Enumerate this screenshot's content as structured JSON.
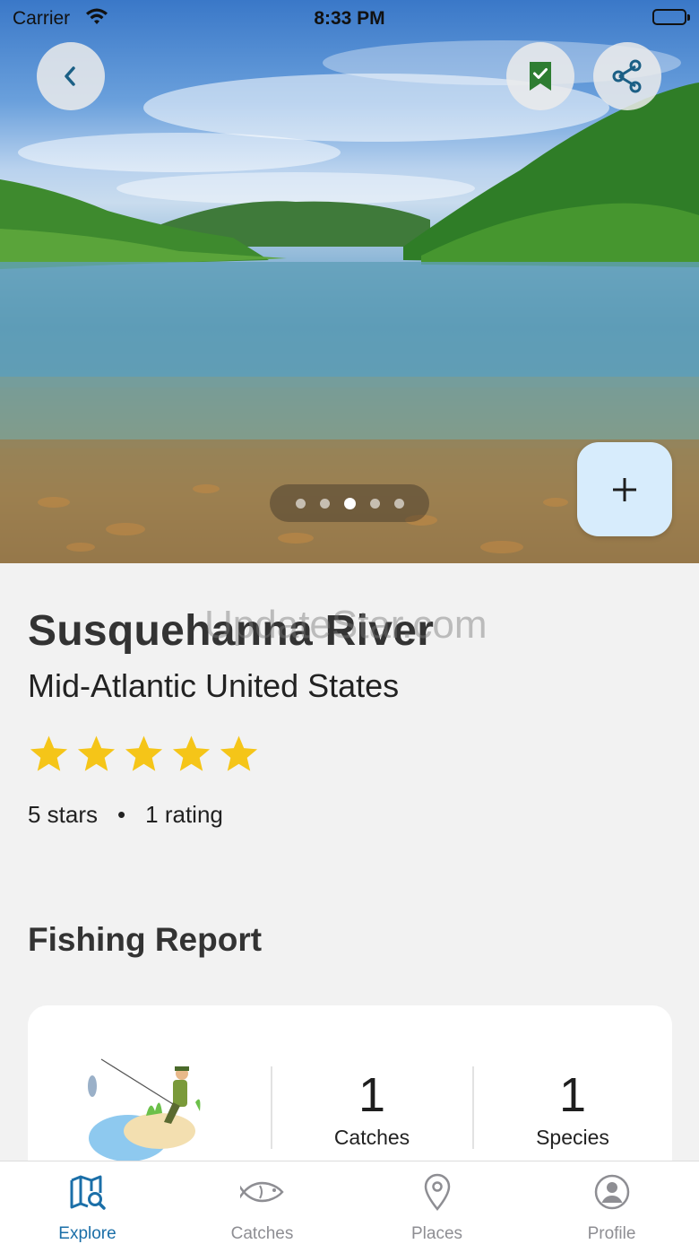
{
  "status_bar": {
    "carrier": "Carrier",
    "time": "8:33 PM"
  },
  "hero": {
    "image_description_icon": "river-landscape-photo",
    "page_count": 5,
    "active_page": 3,
    "back_icon": "chevron-left-icon",
    "bookmark_icon": "bookmark-check-icon",
    "share_icon": "share-icon",
    "add_icon": "plus-icon"
  },
  "place": {
    "name": "Susquehanna River",
    "region": "Mid-Atlantic United States",
    "watermark": "UpdateStar.com",
    "star_count": 5,
    "stars_text": "5 stars",
    "ratings_text": "1 rating"
  },
  "report": {
    "title": "Fishing Report",
    "catches_value": "1",
    "catches_label": "Catches",
    "species_value": "1",
    "species_label": "Species"
  },
  "tabs": [
    {
      "label": "Explore",
      "icon": "map-search-icon",
      "active": true
    },
    {
      "label": "Catches",
      "icon": "fish-icon",
      "active": false
    },
    {
      "label": "Places",
      "icon": "location-pin-icon",
      "active": false
    },
    {
      "label": "Profile",
      "icon": "person-circle-icon",
      "active": false
    }
  ],
  "colors": {
    "accent": "#1b6fa8",
    "star": "#f5c518",
    "bookmark": "#2e7d32",
    "fab_bg": "#d7ecfc",
    "tab_inactive": "#8e8e93"
  }
}
